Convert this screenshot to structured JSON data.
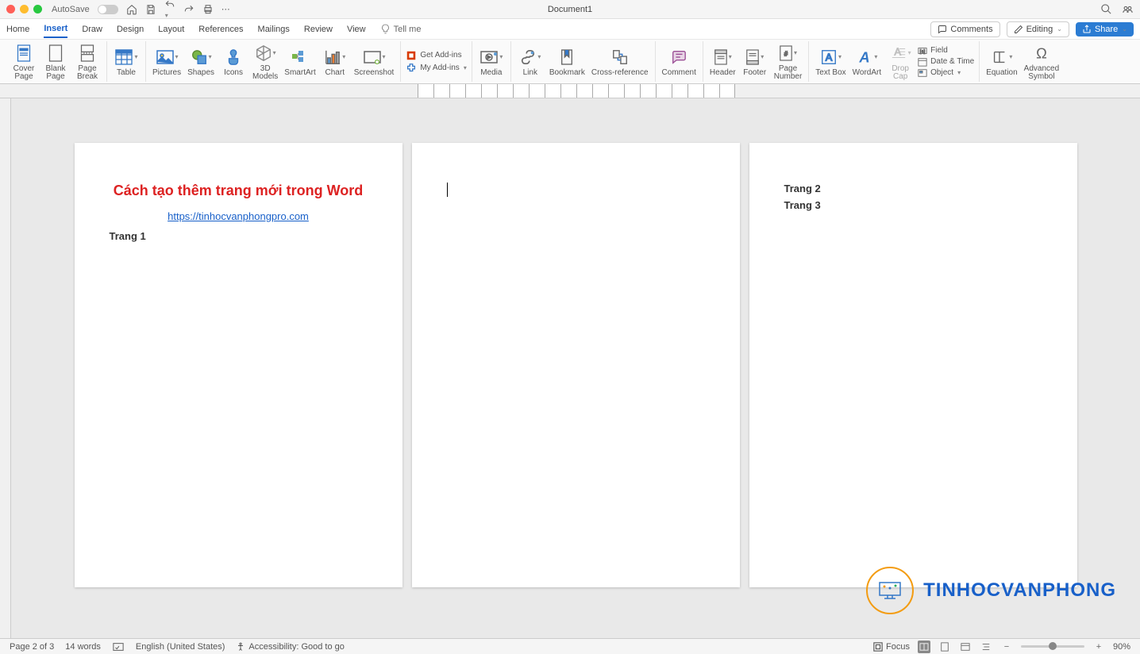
{
  "titlebar": {
    "autosave": "AutoSave",
    "docname": "Document1"
  },
  "tabs": [
    "Home",
    "Insert",
    "Draw",
    "Design",
    "Layout",
    "References",
    "Mailings",
    "Review",
    "View"
  ],
  "tellme": "Tell me",
  "topright": {
    "comments": "Comments",
    "editing": "Editing",
    "share": "Share"
  },
  "ribbon": {
    "pages": {
      "cover": "Cover\nPage",
      "blank": "Blank\nPage",
      "break": "Page\nBreak"
    },
    "table": "Table",
    "illus": {
      "pictures": "Pictures",
      "shapes": "Shapes",
      "icons": "Icons",
      "models": "3D\nModels",
      "smartart": "SmartArt",
      "chart": "Chart",
      "screenshot": "Screenshot"
    },
    "addins": {
      "get": "Get Add-ins",
      "my": "My Add-ins"
    },
    "media": "Media",
    "links": {
      "link": "Link",
      "bookmark": "Bookmark",
      "xref": "Cross-reference"
    },
    "comment": "Comment",
    "hf": {
      "header": "Header",
      "footer": "Footer",
      "pagenum": "Page\nNumber"
    },
    "text": {
      "textbox": "Text Box",
      "wordart": "WordArt",
      "dropcap": "Drop\nCap",
      "field": "Field",
      "datetime": "Date & Time",
      "object": "Object"
    },
    "sym": {
      "equation": "Equation",
      "advsym": "Advanced\nSymbol"
    }
  },
  "pages_content": {
    "p1": {
      "title": "Cách tạo thêm trang mới trong Word",
      "link": "https://tinhocvanphongpro.com",
      "line": "Trang 1"
    },
    "p3": {
      "l1": "Trang 2",
      "l2": "Trang 3"
    }
  },
  "watermark": "TINHOCVANPHONG",
  "status": {
    "page": "Page 2 of 3",
    "words": "14 words",
    "lang": "English (United States)",
    "access": "Accessibility: Good to go",
    "focus": "Focus",
    "zoom": "90%"
  }
}
